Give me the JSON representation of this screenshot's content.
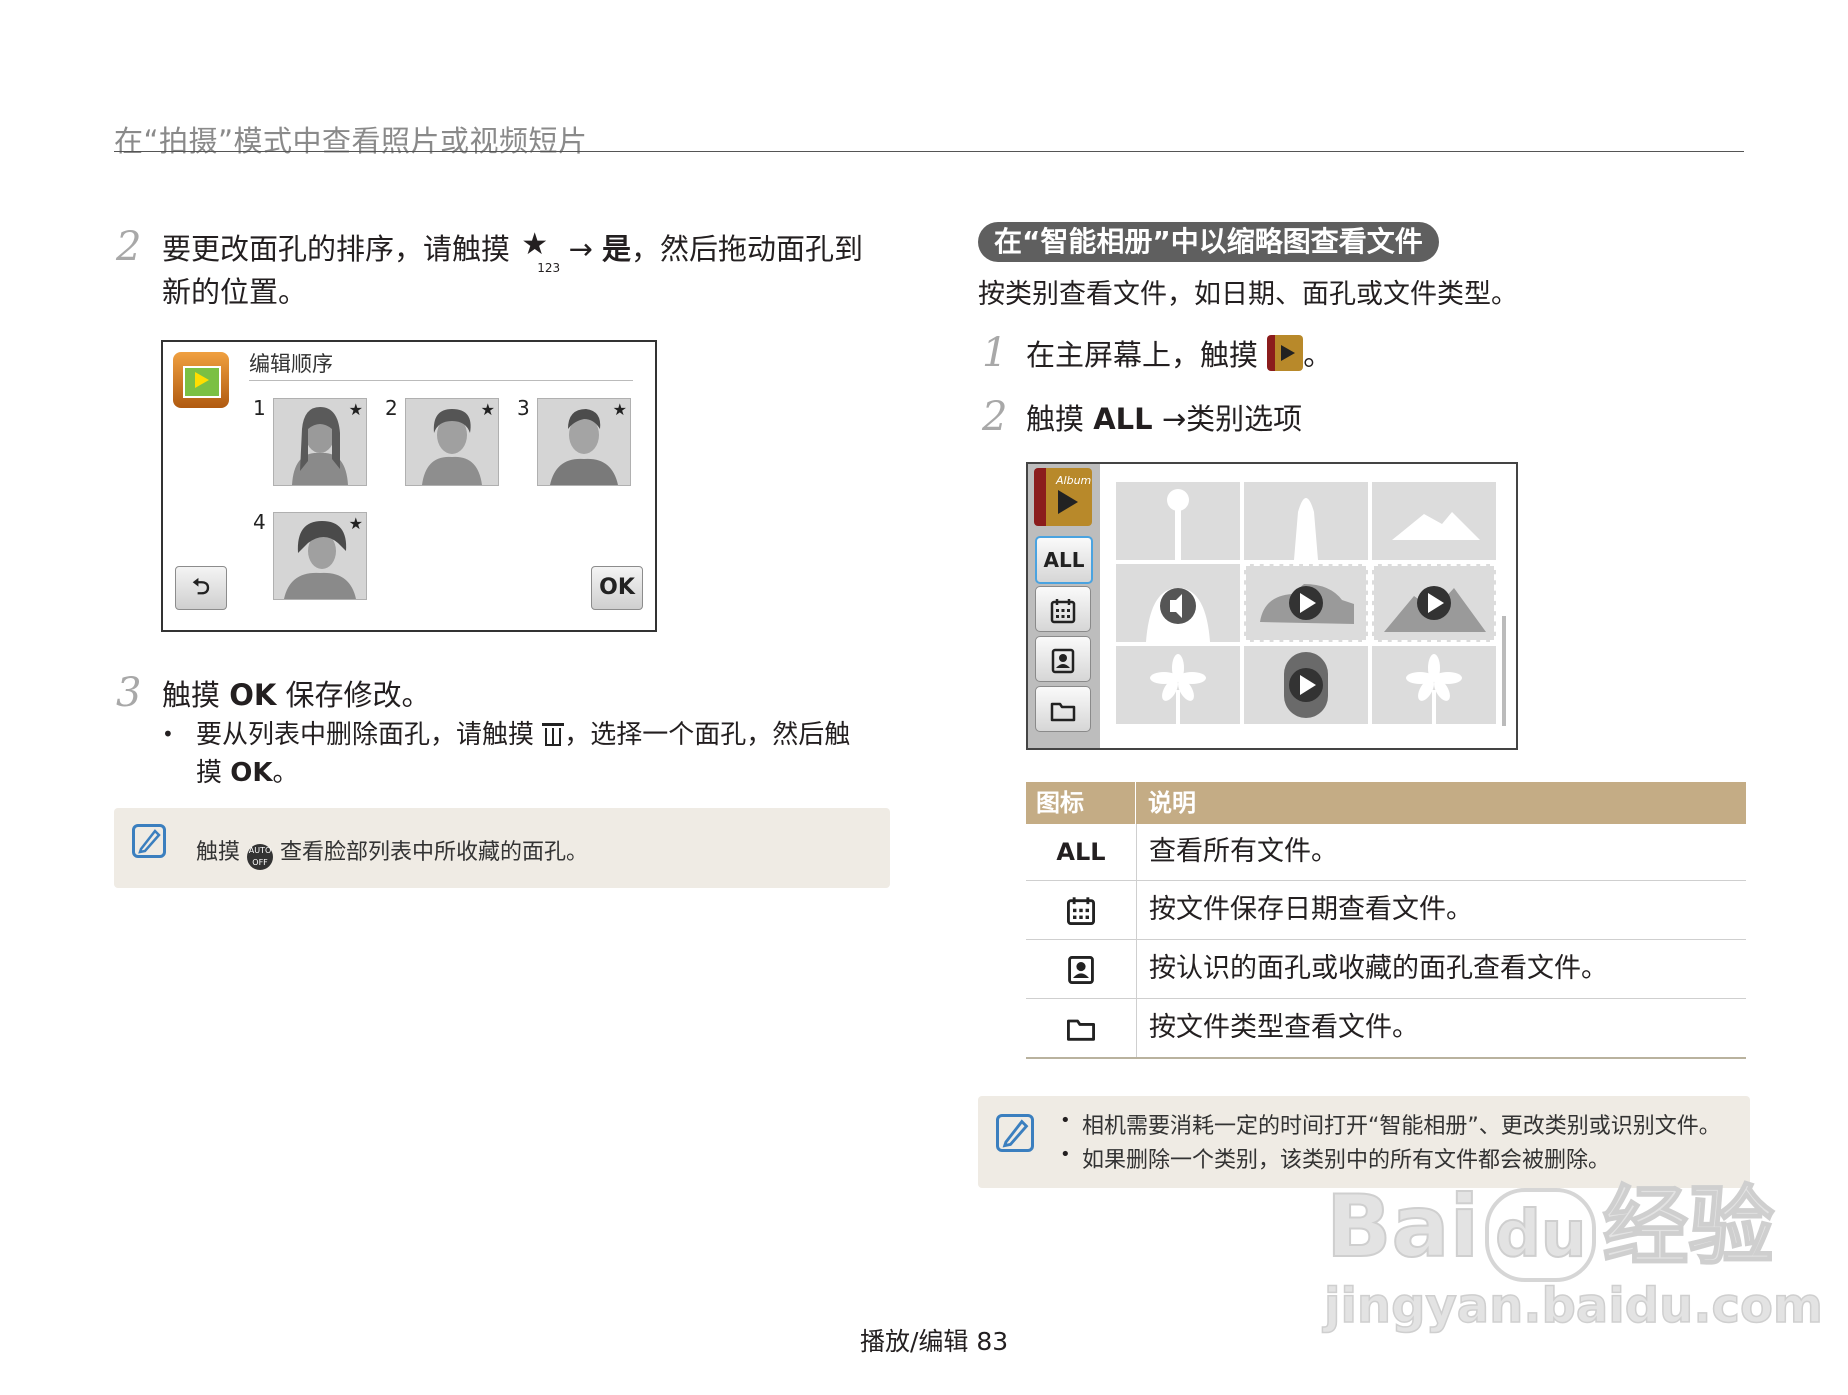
{
  "page": {
    "title": "在“拍摄”模式中查看照片或视频短片",
    "footer": "播放/编辑 83"
  },
  "left": {
    "step2": {
      "num": "2",
      "text_a": "要更改面孔的排序，请触摸",
      "arrow": "→",
      "yes": "是",
      "text_b": "，然后拖动面孔到",
      "line2": "新的位置。"
    },
    "screen": {
      "title": "编辑顺序",
      "faces": [
        {
          "num": "1",
          "star": "★"
        },
        {
          "num": "2",
          "star": "★"
        },
        {
          "num": "3",
          "star": "★"
        },
        {
          "num": "4",
          "star": "★"
        }
      ],
      "back": "⮌",
      "ok": "OK"
    },
    "step3": {
      "num": "3",
      "text_a": "触摸 ",
      "ok": "OK",
      "text_b": " 保存修改。",
      "bullet": "•",
      "sub_a": "要从列表中删除面孔，请触摸",
      "sub_b": "，选择一个面孔，然后触",
      "sub_c": "摸 ",
      "sub_ok": "OK",
      "sub_d": "。"
    },
    "note": {
      "text_a": "触摸",
      "text_b": "查看脸部列表中所收藏的面孔。"
    }
  },
  "right": {
    "section_pill": "在“智能相册”中以缩略图查看文件",
    "intro": "按类别查看文件，如日期、面孔或文件类型。",
    "step1": {
      "num": "1",
      "text": "在主屏幕上，触摸",
      "end": "。"
    },
    "step2": {
      "num": "2",
      "text_a": "触摸 ",
      "all": "ALL",
      "text_b": " →类别选项"
    },
    "album": {
      "side_all": "ALL",
      "album_label": "Album"
    },
    "table": {
      "headers": [
        "图标",
        "说明"
      ],
      "rows": [
        {
          "icon": "ALL",
          "desc": "查看所有文件。"
        },
        {
          "icon": "calendar-icon",
          "desc": "按文件保存日期查看文件。"
        },
        {
          "icon": "face-icon",
          "desc": "按认识的面孔或收藏的面孔查看文件。"
        },
        {
          "icon": "folder-icon",
          "desc": "按文件类型查看文件。"
        }
      ]
    },
    "note": {
      "bullet": "•",
      "line1": "相机需要消耗一定的时间打开“智能相册”、更改类别或识别文件。",
      "line2": "如果删除一个类别，该类别中的所有文件都会被删除。"
    }
  },
  "watermark": {
    "brand": "Bai",
    "paw": "du",
    "suffix": "经验",
    "url": "jingyan.baidu.com"
  },
  "colors": {
    "accent_tan": "#c4ac85",
    "note_bg": "#efebe4",
    "pill_bg": "#5f5f5f"
  }
}
